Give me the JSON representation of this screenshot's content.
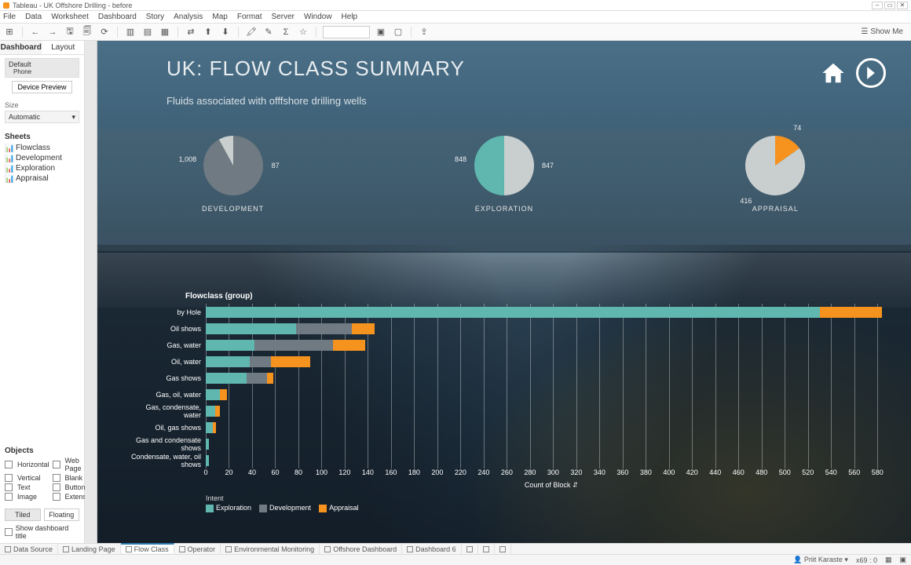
{
  "window": {
    "title": "Tableau - UK Offshore Drilling - before"
  },
  "menu": [
    "File",
    "Data",
    "Worksheet",
    "Dashboard",
    "Story",
    "Analysis",
    "Map",
    "Format",
    "Server",
    "Window",
    "Help"
  ],
  "showme": "Show Me",
  "side": {
    "tabs": {
      "dashboard": "Dashboard",
      "layout": "Layout"
    },
    "default_label": "Default",
    "default_value": "Phone",
    "preview_btn": "Device Preview",
    "size_label": "Size",
    "size_value": "Automatic",
    "sheets_label": "Sheets",
    "sheets": [
      "Flowclass",
      "Development",
      "Exploration",
      "Appraisal"
    ],
    "objects_label": "Objects",
    "objects": [
      "Horizontal",
      "Web Page",
      "Vertical",
      "Blank",
      "Text",
      "Button",
      "Image",
      "Extension"
    ],
    "tiled": "Tiled",
    "floating": "Floating",
    "show_title": "Show dashboard title"
  },
  "dash": {
    "title": "UK: FLOW CLASS SUMMARY",
    "subtitle": "Fluids associated with offfshore drilling wells",
    "bar_title": "Flowclass (group)",
    "x_label": "Count of Block",
    "legend_title": "Intent",
    "legend": {
      "exp": "Exploration",
      "dev": "Development",
      "app": "Appraisal"
    }
  },
  "chart_data": {
    "pies": [
      {
        "label": "DEVELOPMENT",
        "slices": [
          {
            "name": "left",
            "value": 1008,
            "color": "#6f7a82"
          },
          {
            "name": "right",
            "value": 87,
            "color": "#c9cfcf"
          }
        ]
      },
      {
        "label": "EXPLORATION",
        "slices": [
          {
            "name": "left",
            "value": 848,
            "color": "#c9cfcf"
          },
          {
            "name": "right",
            "value": 847,
            "color": "#5fb7b0"
          }
        ]
      },
      {
        "label": "APPRAISAL",
        "slices": [
          {
            "name": "top",
            "value": 74,
            "color": "#f6921e"
          },
          {
            "name": "rest",
            "value": 416,
            "color": "#c9cfcf"
          }
        ]
      }
    ],
    "bars": {
      "type": "bar",
      "xlabel": "Count of Block",
      "xlim": [
        0,
        590
      ],
      "xticks": [
        0,
        20,
        40,
        60,
        80,
        100,
        120,
        140,
        160,
        180,
        200,
        220,
        240,
        260,
        280,
        300,
        320,
        340,
        360,
        380,
        400,
        420,
        440,
        460,
        480,
        500,
        520,
        540,
        560,
        580
      ],
      "categories": [
        "by Hole",
        "Oil shows",
        "Gas, water",
        "Oil, water",
        "Gas shows",
        "Gas, oil, water",
        "Gas, condensate, water",
        "Oil, gas shows",
        "Gas and condensate shows",
        "Condensate, water, oil shows"
      ],
      "series": [
        {
          "name": "Exploration",
          "color": "#5fb7b0",
          "values": [
            530,
            78,
            42,
            38,
            35,
            12,
            8,
            6,
            3,
            3
          ]
        },
        {
          "name": "Development",
          "color": "#6f7a82",
          "values": [
            0,
            48,
            68,
            18,
            18,
            0,
            0,
            0,
            0,
            0
          ]
        },
        {
          "name": "Appraisal",
          "color": "#f6921e",
          "values": [
            54,
            20,
            28,
            34,
            5,
            6,
            4,
            3,
            0,
            0
          ]
        }
      ]
    }
  },
  "sheettabs": [
    "Data Source",
    "Landing Page",
    "Flow Class",
    "Operator",
    "Environmental Monitoring",
    "Offshore Dashboard",
    "Dashboard 6"
  ],
  "sheettab_active": 2,
  "status": {
    "user": "Priit Karaste",
    "marks": "x69 : 0"
  }
}
